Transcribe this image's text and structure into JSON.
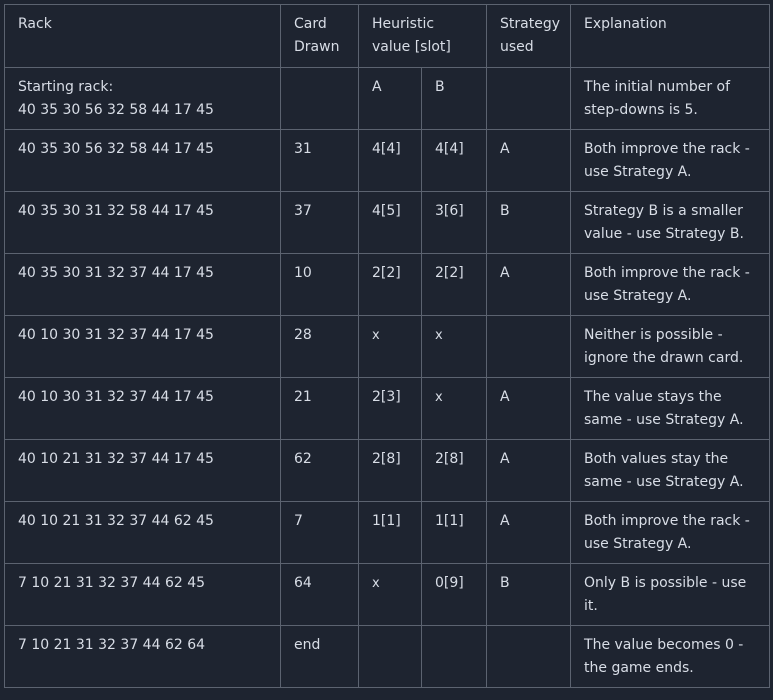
{
  "headers": {
    "rack": "Rack",
    "card_line1": "Card",
    "card_line2": "Drawn",
    "heuristic_line1": "Heuristic",
    "heuristic_line2": "value [slot]",
    "strategy_line1": "Strategy",
    "strategy_line2": "used",
    "explanation": "Explanation"
  },
  "start_row": {
    "rack_line1": "Starting rack:",
    "rack_line2": "40 35 30 56 32 58 44 17 45",
    "a": "A",
    "b": "B",
    "explanation": "The initial number of step-downs is 5."
  },
  "rows": [
    {
      "rack": "40 35 30 56 32 58 44 17 45",
      "card": "31",
      "a": "4[4]",
      "b": "4[4]",
      "strategy": "A",
      "explanation": "Both improve the rack - use Strategy A."
    },
    {
      "rack": "40 35 30 31 32 58 44 17 45",
      "card": "37",
      "a": "4[5]",
      "b": "3[6]",
      "strategy": "B",
      "explanation": "Strategy B is a smaller value - use Strategy B."
    },
    {
      "rack": "40 35 30 31 32 37 44 17 45",
      "card": "10",
      "a": "2[2]",
      "b": "2[2]",
      "strategy": "A",
      "explanation": "Both improve the rack - use Strategy A."
    },
    {
      "rack": "40 10 30 31 32 37 44 17 45",
      "card": "28",
      "a": "x",
      "b": "x",
      "strategy": "",
      "explanation": "Neither is possible - ignore the drawn card."
    },
    {
      "rack": "40 10 30 31 32 37 44 17 45",
      "card": "21",
      "a": "2[3]",
      "b": "x",
      "strategy": "A",
      "explanation": "The value stays the same - use Strategy A."
    },
    {
      "rack": "40 10 21 31 32 37 44 17 45",
      "card": "62",
      "a": "2[8]",
      "b": "2[8]",
      "strategy": "A",
      "explanation": "Both values stay the same - use Strategy A."
    },
    {
      "rack": "40 10 21 31 32 37 44 62 45",
      "card": "7",
      "a": "1[1]",
      "b": "1[1]",
      "strategy": "A",
      "explanation": "Both improve the rack - use Strategy A."
    },
    {
      "rack": "7 10 21 31 32 37 44 62 45",
      "card": "64",
      "a": "x",
      "b": "0[9]",
      "strategy": "B",
      "explanation": "Only B is possible - use it."
    },
    {
      "rack": "7 10 21 31 32 37 44 62 64",
      "card": "end",
      "a": "",
      "b": "",
      "strategy": "",
      "explanation": "The value becomes 0 - the game ends."
    }
  ]
}
